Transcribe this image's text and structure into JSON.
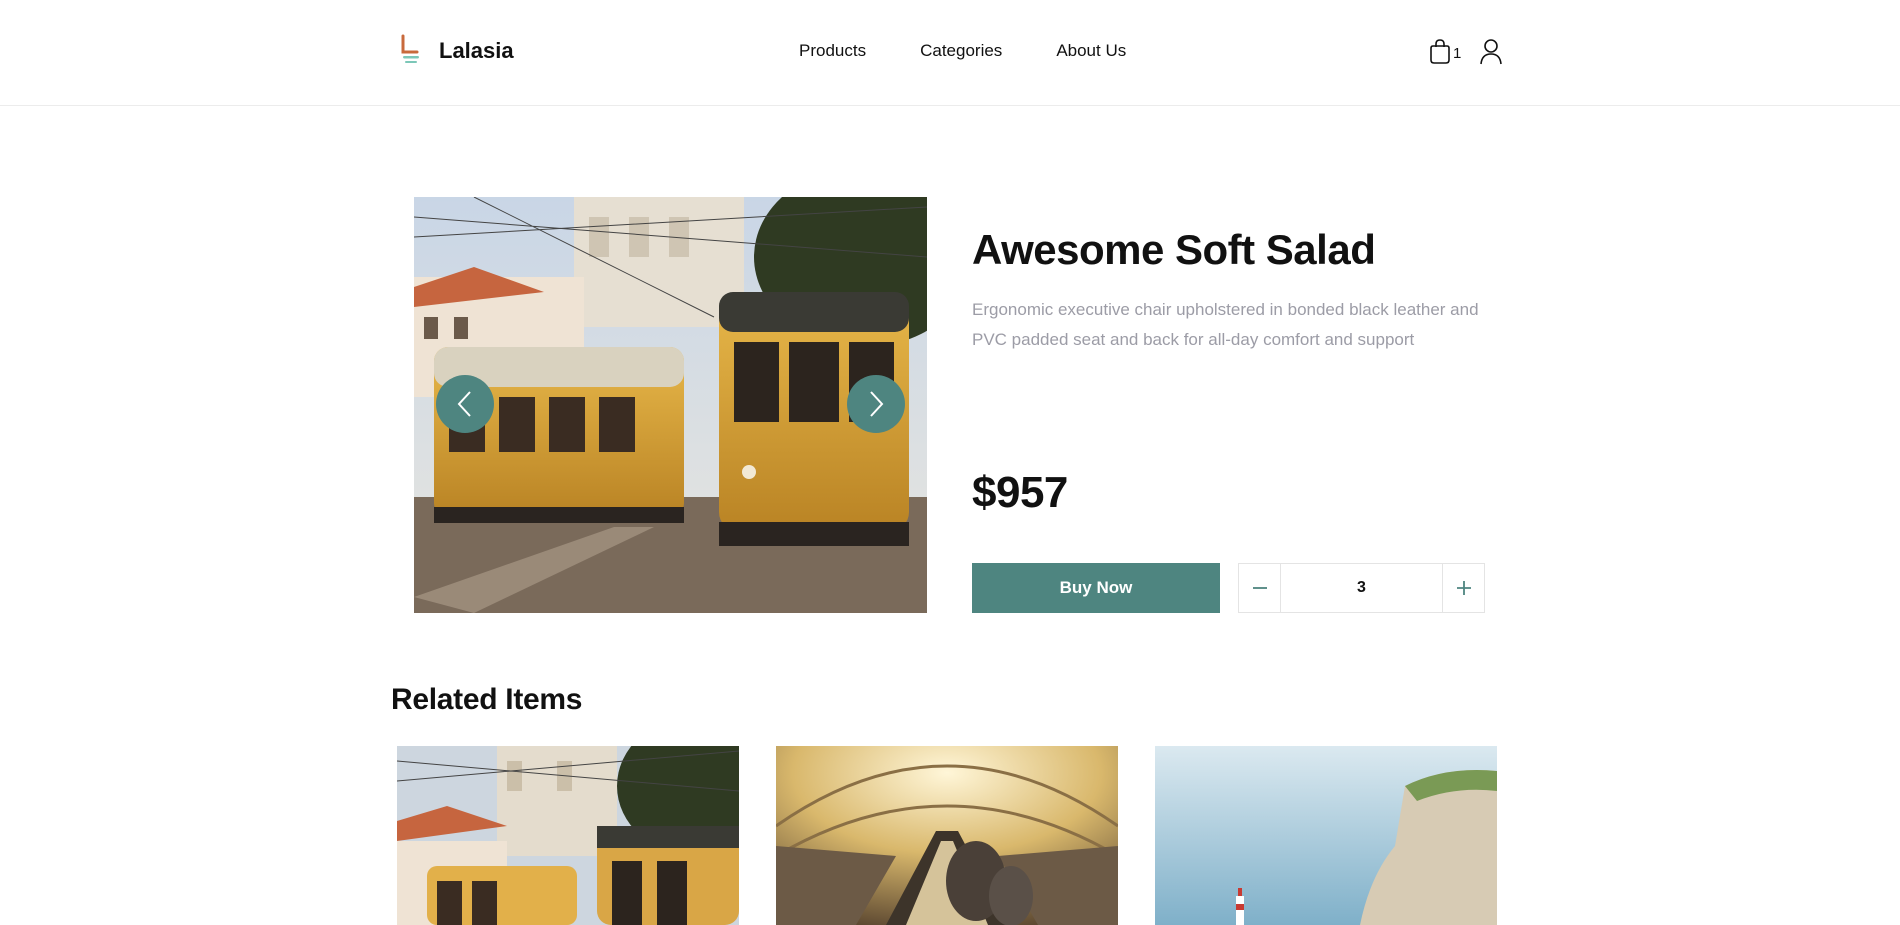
{
  "brand": {
    "name": "Lalasia",
    "accent_color": "#4e8580",
    "logo_icon": "chair-logo-icon"
  },
  "nav": {
    "items": [
      {
        "label": "Products"
      },
      {
        "label": "Categories"
      },
      {
        "label": "About Us"
      }
    ]
  },
  "header": {
    "cart_icon": "shopping-bag-icon",
    "cart_count": "1",
    "user_icon": "user-icon"
  },
  "product": {
    "title": "Awesome Soft Salad",
    "description": "Ergonomic executive chair upholstered in bonded black leather and PVC padded seat and back for all-day comfort and support",
    "price": "$957",
    "buy_label": "Buy Now",
    "quantity": "3",
    "image": "photo of yellow trams in a city street",
    "carousel": {
      "prev_icon": "chevron-left-icon",
      "next_icon": "chevron-right-icon"
    }
  },
  "related": {
    "title": "Related Items",
    "items": [
      {
        "image": "photo of yellow trams near a church"
      },
      {
        "image": "photo of an escalator in a tunnel"
      },
      {
        "image": "photo of a lighthouse by a chalk cliff"
      }
    ]
  },
  "icons": {
    "minus": "minus-icon",
    "plus": "plus-icon"
  }
}
